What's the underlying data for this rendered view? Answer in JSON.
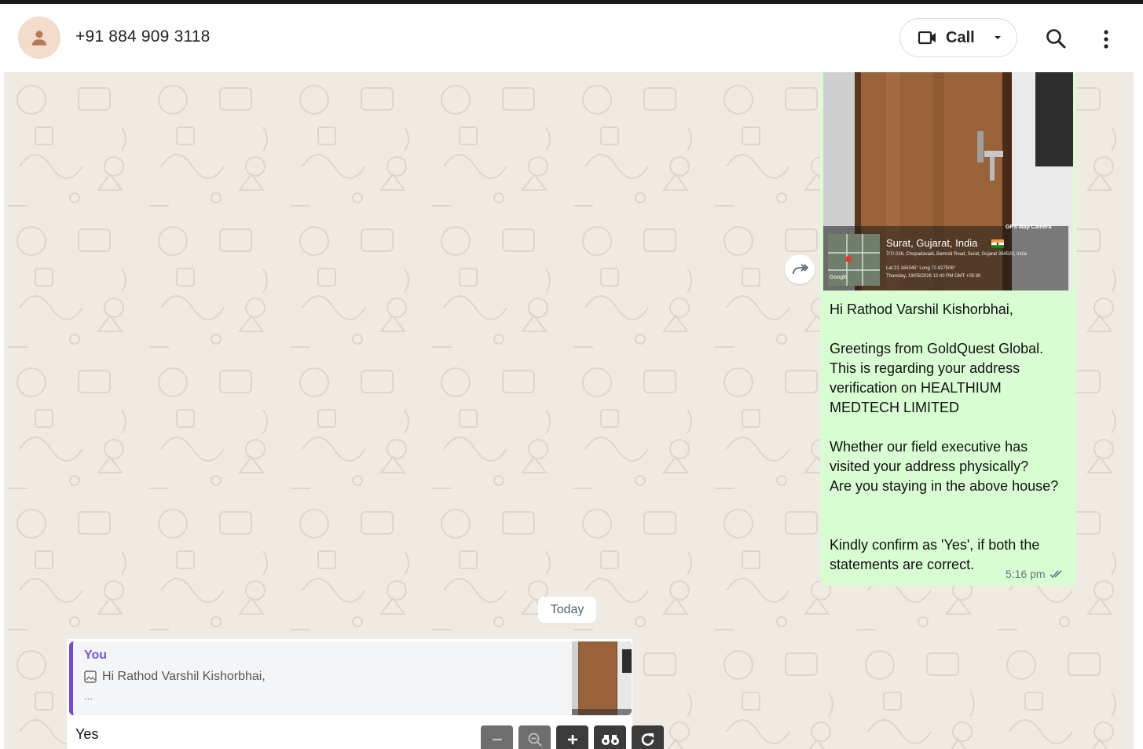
{
  "header": {
    "contact_name": "+91 884 909 3118",
    "call_label": "Call",
    "icons": [
      "person-icon",
      "video-camera-icon",
      "chevron-down-icon",
      "search-icon",
      "more-vert-icon"
    ]
  },
  "message": {
    "photo_overlay": {
      "app_tag": "GPS Map Camera",
      "location": "Surat, Gujarat, India",
      "address": "7/7/-226, Chopadavadi, Bamroli Road, Surat, Gujarat 394520, India",
      "latlong": "Lat 21.165345° Long 72.827506°",
      "datetime": "Thursday, 19/05/2026 12:40 PM GMT +05:30",
      "map_label": "Google"
    },
    "text": "Hi Rathod Varshil Kishorbhai,\n\nGreetings from GoldQuest Global. This is regarding your address verification on HEALTHIUM MEDTECH LIMITED\n\nWhether our field executive has visited your address physically?\nAre you staying in the above house?\n\n\nKindly confirm as 'Yes', if both the statements are correct.",
    "time": "5:16 pm",
    "status": "read"
  },
  "date_divider": "Today",
  "reply": {
    "quote_author": "You",
    "quote_text": "Hi Rathod Varshil Kishorbhai,",
    "quote_more": "...",
    "text": "Yes"
  },
  "zoom_controls": [
    "zoom-out-icon",
    "magnify-minus-icon",
    "zoom-in-icon",
    "binoculars-icon",
    "rotate-icon"
  ],
  "colors": {
    "chat_background": "#efeae2",
    "outgoing_bubble": "#d9fdd3",
    "quote_accent": "#6f4bd6",
    "avatar_bg": "#f3dccb"
  }
}
